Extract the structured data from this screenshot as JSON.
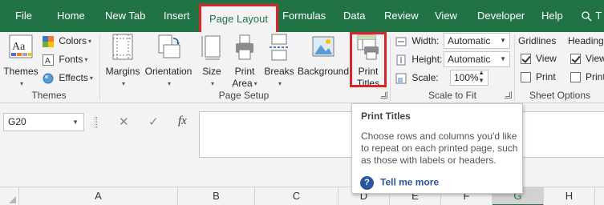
{
  "tabs": [
    {
      "label": "File"
    },
    {
      "label": "Home"
    },
    {
      "label": "New Tab"
    },
    {
      "label": "Insert"
    },
    {
      "label": "Page Layout"
    },
    {
      "label": "Formulas"
    },
    {
      "label": "Data"
    },
    {
      "label": "Review"
    },
    {
      "label": "View"
    },
    {
      "label": "Developer"
    },
    {
      "label": "Help"
    },
    {
      "label": "T"
    }
  ],
  "themes_group": {
    "themes_label": "Themes",
    "colors_label": "Colors",
    "fonts_label": "Fonts",
    "effects_label": "Effects",
    "group_label": "Themes"
  },
  "page_setup": {
    "margins_label": "Margins",
    "orientation_label": "Orientation",
    "size_label": "Size",
    "print_area_line1": "Print",
    "print_area_line2": "Area",
    "breaks_label": "Breaks",
    "background_label": "Background",
    "print_titles_line1": "Print",
    "print_titles_line2": "Titles",
    "group_label": "Page Setup"
  },
  "scale_to_fit": {
    "width_label": "Width:",
    "width_value": "Automatic",
    "height_label": "Height:",
    "height_value": "Automatic",
    "scale_label": "Scale:",
    "scale_value": "100%",
    "group_label": "Scale to Fit"
  },
  "sheet_options": {
    "gridlines_label": "Gridlines",
    "gridlines_view_label": "View",
    "gridlines_view_checked": true,
    "gridlines_print_label": "Print",
    "gridlines_print_checked": false,
    "headings_label": "Heading",
    "headings_view_label": "View",
    "headings_view_checked": true,
    "headings_print_label": "Print",
    "headings_print_checked": false,
    "group_label": "Sheet Options"
  },
  "formula_bar": {
    "name_box": "G20",
    "cancel_symbol": "✕",
    "enter_symbol": "✓",
    "fx_symbol": "fx",
    "formula": ""
  },
  "columns": [
    "A",
    "B",
    "C",
    "D",
    "E",
    "F",
    "G",
    "H"
  ],
  "selected_column": "G",
  "tooltip": {
    "title": "Print Titles",
    "body": "Choose rows and columns you'd like to repeat on each printed page, such as those with labels or headers.",
    "link_icon": "?",
    "link": "Tell me more"
  },
  "colors": {
    "brand": "#217346",
    "highlight": "#d6252b",
    "link": "#2b579a"
  }
}
